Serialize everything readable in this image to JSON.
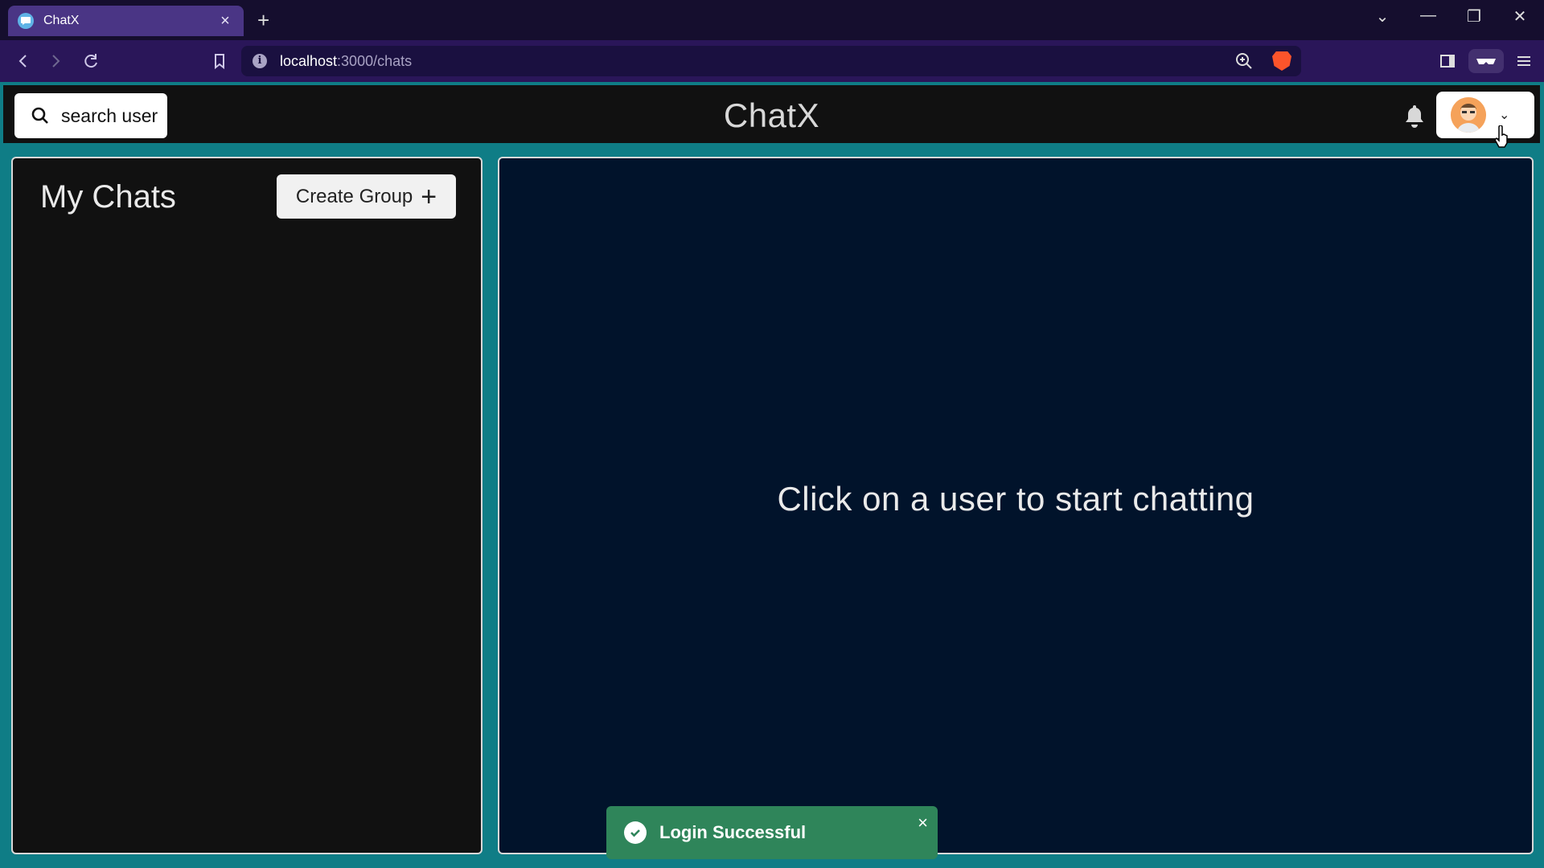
{
  "browser": {
    "tab_title": "ChatX",
    "tab_close": "×",
    "new_tab": "+",
    "url_host": "localhost",
    "url_path": ":3000/chats",
    "window_controls": [
      "⌄",
      "—",
      "❐",
      "✕"
    ]
  },
  "header": {
    "search_label": "search user",
    "brand": "ChatX",
    "profile_chevron": "⌄"
  },
  "sidebar": {
    "title": "My Chats",
    "create_group_label": "Create Group",
    "create_group_icon": "+"
  },
  "main": {
    "placeholder": "Click on a user to start chatting"
  },
  "toast": {
    "message": "Login Successful",
    "close": "×"
  },
  "colors": {
    "page_bg": "#0f7d86",
    "header_bg": "#111111",
    "chat_bg": "#01132b",
    "toast_bg": "#2f855a",
    "browser_tab": "#4a3585"
  }
}
